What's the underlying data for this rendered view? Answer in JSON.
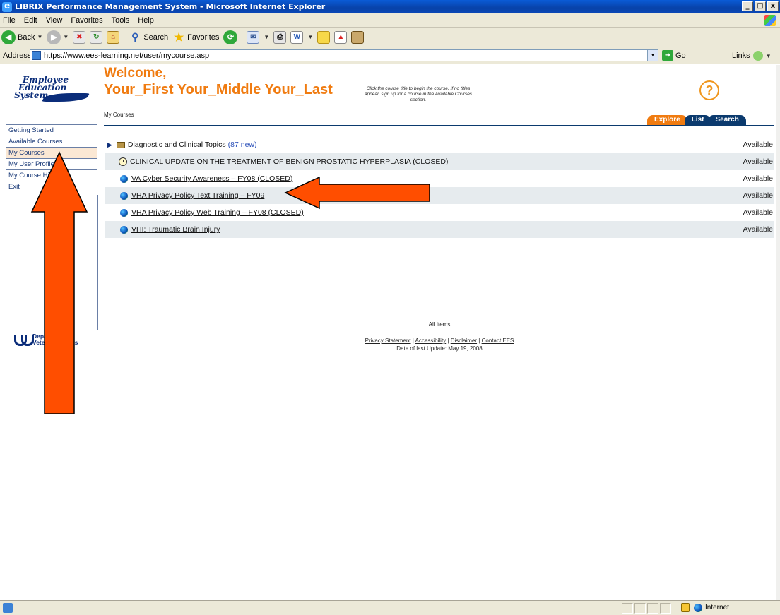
{
  "window": {
    "title": "LIBRIX Performance Management System - Microsoft Internet Explorer",
    "buttons": [
      "_",
      "□",
      "x"
    ]
  },
  "menu": [
    "File",
    "Edit",
    "View",
    "Favorites",
    "Tools",
    "Help"
  ],
  "toolbar": {
    "back_label": "Back",
    "search_label": "Search",
    "favorites_label": "Favorites"
  },
  "address": {
    "label": "Address",
    "url": "https://www.ees-learning.net/user/mycourse.asp",
    "go_label": "Go",
    "links_label": "Links"
  },
  "header": {
    "logo_line1": "Employee",
    "logo_line2": "Education",
    "logo_line3": "System",
    "welcome": "Welcome,",
    "user_name": "Your_First Your_Middle Your_Last",
    "instructions": "Click the course title to begin the course. If no titles appear, sign up for a course in the Available Courses section.",
    "breadcrumb": "My Courses",
    "help_glyph": "?"
  },
  "tabs": [
    "Explore",
    "List",
    "Search"
  ],
  "sidebar": {
    "items": [
      {
        "label": "Getting Started"
      },
      {
        "label": "Available Courses"
      },
      {
        "label": "My Courses"
      },
      {
        "label": "My User Profile"
      },
      {
        "label": "My Course History"
      },
      {
        "label": "Exit"
      }
    ]
  },
  "courses": [
    {
      "title": "Diagnostic and Clinical Topics",
      "extra": "(87 new)",
      "status": "Available",
      "icon": "folder"
    },
    {
      "title": "CLINICAL UPDATE ON THE TREATMENT OF BENIGN PROSTATIC HYPERPLASIA (CLOSED)",
      "extra": "",
      "status": "Available",
      "icon": "clock"
    },
    {
      "title": "VA Cyber Security Awareness – FY08 (CLOSED)",
      "extra": "",
      "status": "Available",
      "icon": "globe"
    },
    {
      "title": "VHA Privacy Policy Text Training – FY09",
      "extra": "",
      "status": "Available",
      "icon": "globe"
    },
    {
      "title": "VHA Privacy Policy Web Training – FY08 (CLOSED)",
      "extra": "",
      "status": "Available",
      "icon": "globe"
    },
    {
      "title": "VHI: Traumatic Brain Injury",
      "extra": "",
      "status": "Available",
      "icon": "globe"
    }
  ],
  "footer": {
    "all_items": "All Items",
    "links": [
      "Privacy Statement",
      "Accessibility",
      "Disclaimer",
      "Contact EES"
    ],
    "last_update": "Date of last Update: May 19, 2008",
    "va_line1": "Department of",
    "va_line2": "Veterans Affairs"
  },
  "status": {
    "zone": "Internet"
  },
  "colors": {
    "accent_orange": "#f07b10",
    "navy": "#0b3a6e",
    "arrow": "#ff4e00"
  }
}
